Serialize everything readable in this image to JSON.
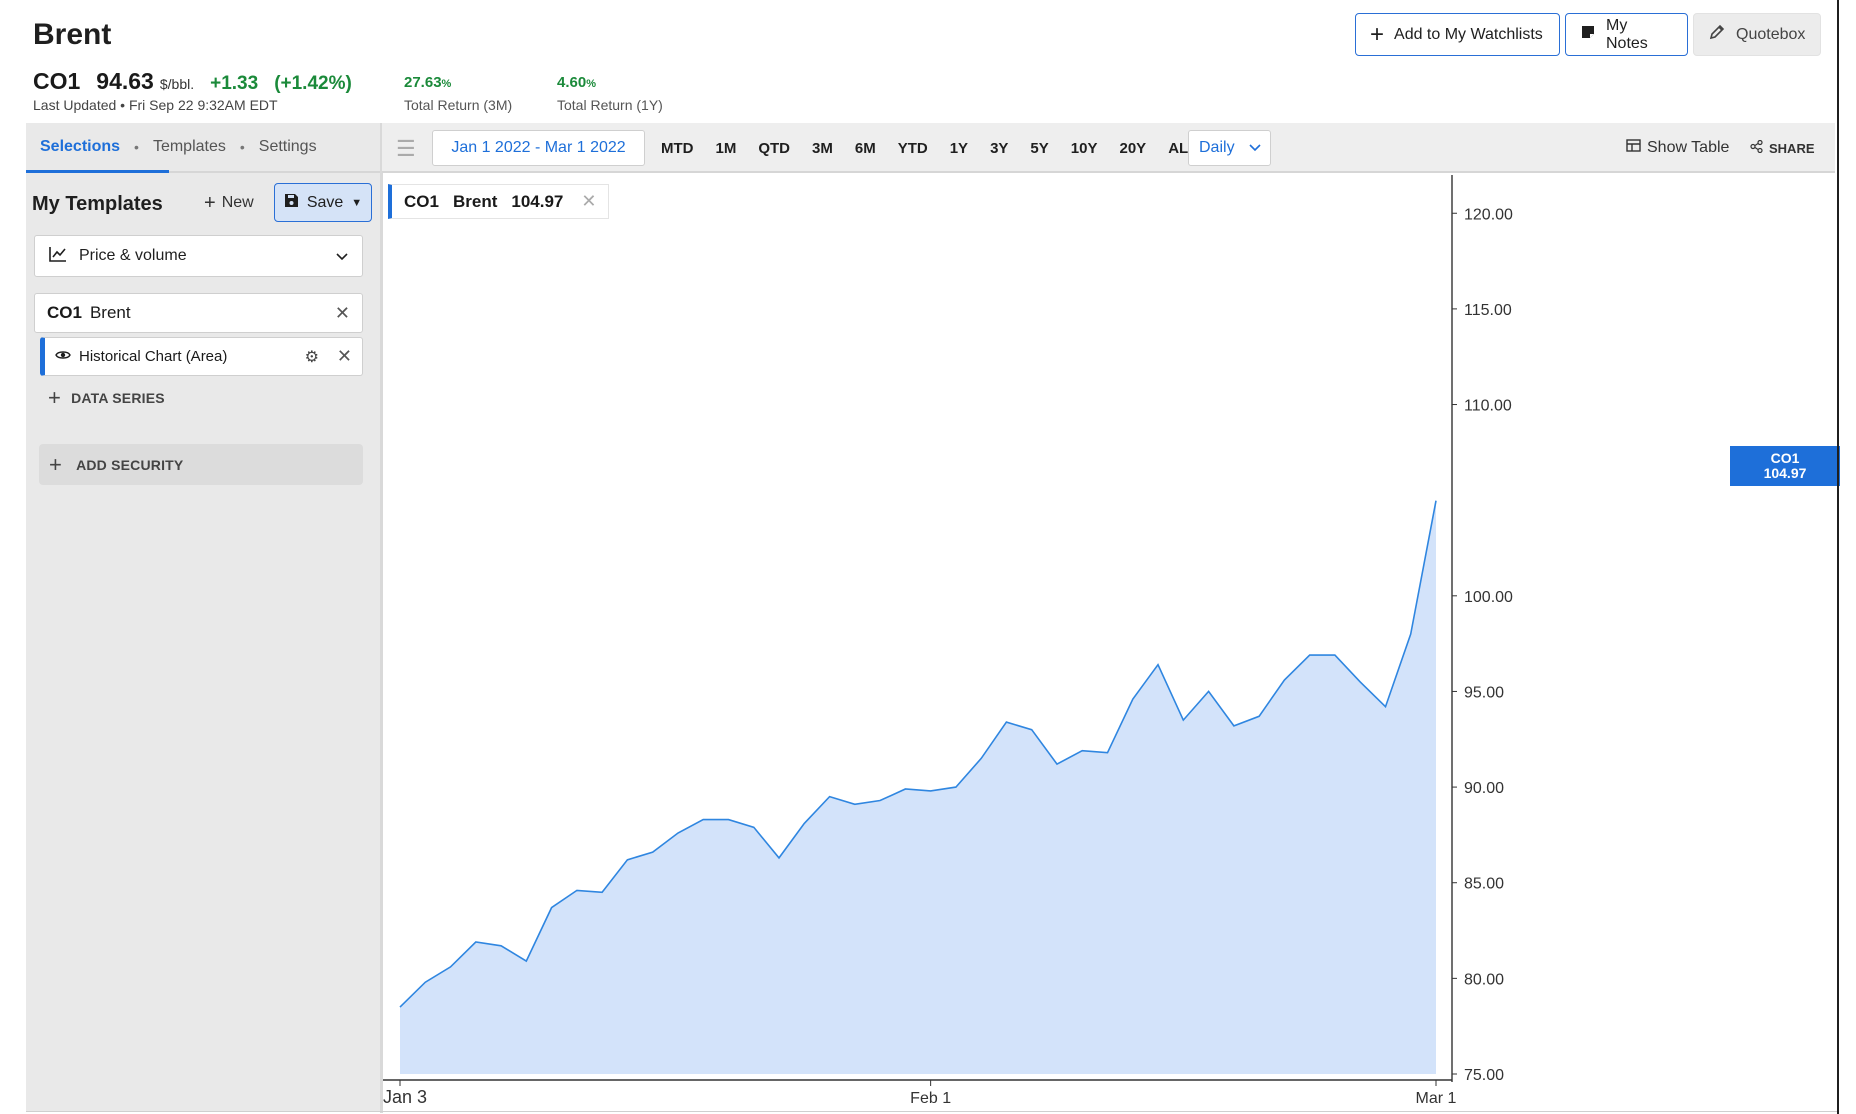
{
  "header": {
    "title": "Brent",
    "ticker": "CO1",
    "price": "94.63",
    "unit": "$/bbl.",
    "change": "+1.33",
    "change_pct": "(+1.42%)",
    "last_updated": "Last Updated • Fri Sep 22 9:32AM EDT",
    "returns": [
      {
        "value": "27.63",
        "suffix": "%",
        "label": "Total Return (3M)"
      },
      {
        "value": "4.60",
        "suffix": "%",
        "label": "Total Return (1Y)"
      }
    ],
    "buttons": {
      "watchlist": "Add to My Watchlists",
      "notes": "My Notes",
      "quotebox": "Quotebox"
    },
    "colors": {
      "accent": "#1e6fd9",
      "positive": "#1b8a3a"
    }
  },
  "left_panel": {
    "tabs": [
      "Selections",
      "Templates",
      "Settings"
    ],
    "active_tab": "Selections",
    "templates_title": "My Templates",
    "new_label": "New",
    "save_label": "Save",
    "template_dropdown": "Price & volume",
    "security": {
      "ticker": "CO1",
      "name": "Brent"
    },
    "series_item": "Historical Chart (Area)",
    "data_series_label": "DATA SERIES",
    "add_security_label": "ADD SECURITY"
  },
  "toolbar": {
    "date_range": "Jan 1 2022 - Mar 1 2022",
    "periods": [
      "MTD",
      "1M",
      "QTD",
      "3M",
      "6M",
      "YTD",
      "1Y",
      "3Y",
      "5Y",
      "10Y",
      "20Y",
      "ALL"
    ],
    "frequency": "Daily",
    "show_table": "Show Table",
    "share": "SHARE"
  },
  "legend": {
    "ticker": "CO1",
    "name": "Brent",
    "value": "104.97"
  },
  "last_tag": {
    "ticker": "CO1",
    "value": "104.97"
  },
  "chart_data": {
    "type": "area",
    "x_ticks": [
      "Jan 3",
      "Feb 1",
      "Mar 1"
    ],
    "y_ticks": [
      "120.00",
      "115.00",
      "110.00",
      "100.00",
      "95.00",
      "90.00",
      "85.00",
      "80.00",
      "75.00"
    ],
    "ylim": [
      75,
      122
    ],
    "series": [
      {
        "values": [
          78.5,
          79.8,
          80.6,
          81.9,
          81.7,
          80.9,
          83.7,
          84.6,
          84.5,
          86.2,
          86.6,
          87.6,
          88.3,
          88.3,
          87.9,
          86.3,
          88.1,
          89.5,
          89.1,
          89.3,
          89.9,
          89.8,
          90.0,
          91.5,
          93.4,
          93.0,
          91.2,
          91.9,
          91.8,
          94.6,
          96.4,
          93.5,
          95.0,
          93.2,
          93.7,
          95.6,
          96.9,
          96.9,
          95.5,
          94.2,
          98.0,
          104.97
        ],
        "color": "#2f86e0"
      }
    ]
  }
}
